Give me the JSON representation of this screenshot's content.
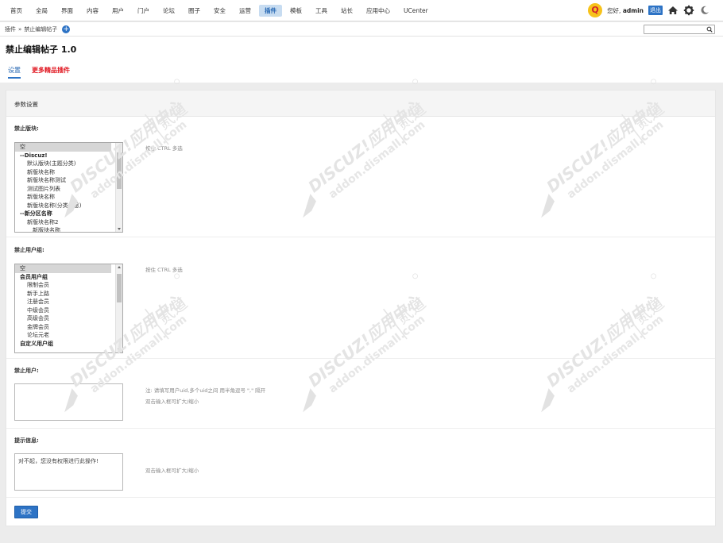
{
  "nav": {
    "items": [
      "首页",
      "全局",
      "界面",
      "内容",
      "用户",
      "门户",
      "论坛",
      "圈子",
      "安全",
      "运营",
      "插件",
      "模板",
      "工具",
      "站长",
      "应用中心",
      "UCenter"
    ],
    "active_index": 10
  },
  "user": {
    "hello": "您好,",
    "name": "admin",
    "logout": "退出"
  },
  "breadcrumb": {
    "parent": "插件",
    "separator": "»",
    "current": "禁止编辑帖子"
  },
  "header": {
    "title": "禁止编辑帖子 1.0",
    "tab_settings": "设置",
    "tab_more": "更多精品插件"
  },
  "panel": {
    "title": "参数设置",
    "forums": {
      "label": "禁止版块:",
      "hint": "按住 CTRL 多选",
      "options": [
        "空",
        "--Discuz!",
        "默认版块(主题分类)",
        "新版块名称",
        "新版块名称测试",
        "测试图片列表",
        "新版块名称",
        "新版块名称(分类信息)",
        "--新分区名称",
        "新版块名称2",
        "新版块名称"
      ]
    },
    "groups": {
      "label": "禁止用户组:",
      "hint": "按住 CTRL 多选",
      "options": [
        "空",
        "会员用户组",
        "限制会员",
        "新手上路",
        "注册会员",
        "中级会员",
        "高级会员",
        "金牌会员",
        "论坛元老",
        "自定义用户组"
      ]
    },
    "users": {
      "label": "禁止用户:",
      "value": "",
      "hint1": "注: 请填写用户uid,多个uid之间 用半角逗号 \",\" 隔开",
      "hint2": "双击输入框可扩大/缩小"
    },
    "message": {
      "label": "提示信息:",
      "value": "对不起，您没有权限进行此操作!",
      "hint": "双击输入框可扩大/缩小"
    },
    "submit": "提交"
  },
  "watermark": {
    "brand": "DISCUZ!应用中心",
    "site": "addon.dismall.com",
    "mark": "贰道"
  },
  "colors": {
    "accent": "#2d73c5",
    "active_tab_bg": "#c7dcf1",
    "promo_red": "#e0141e"
  }
}
